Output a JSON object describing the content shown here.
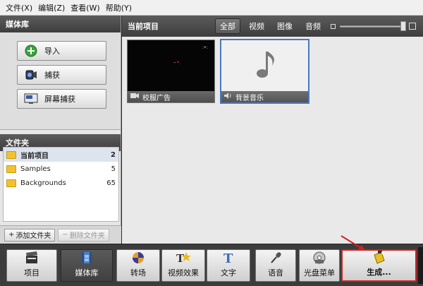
{
  "menu": [
    "文件(X)",
    "编辑(Z)",
    "查看(W)",
    "帮助(Y)"
  ],
  "media_library": {
    "header": "媒体库",
    "buttons": [
      {
        "label": "导入",
        "icon": "plus-circle-icon"
      },
      {
        "label": "捕获",
        "icon": "camcorder-icon"
      },
      {
        "label": "屏幕捕获",
        "icon": "screen-capture-icon"
      }
    ]
  },
  "folders": {
    "header": "文件夹",
    "items": [
      {
        "name": "当前项目",
        "count": "2",
        "selected": true
      },
      {
        "name": "Samples",
        "count": "5",
        "selected": false
      },
      {
        "name": "Backgrounds",
        "count": "65",
        "selected": false
      }
    ],
    "add_label": "添加文件夹",
    "delete_label": "删除文件夹"
  },
  "project": {
    "header": "当前项目",
    "filters": [
      "全部",
      "视频",
      "图像",
      "音频"
    ],
    "active_filter": "全部",
    "items": [
      {
        "name": "校服广告",
        "type": "video"
      },
      {
        "name": "背景音乐",
        "type": "audio",
        "selected": true
      }
    ]
  },
  "toolbar": {
    "items": [
      {
        "label": "项目",
        "icon": "clapperboard-icon"
      },
      {
        "label": "媒体库",
        "icon": "film-strip-icon",
        "active": true
      },
      {
        "label": "转场",
        "icon": "transition-icon"
      },
      {
        "label": "视频效果",
        "icon": "video-effects-icon"
      },
      {
        "label": "文字",
        "icon": "text-t-icon"
      },
      {
        "label": "语音",
        "icon": "microphone-icon"
      },
      {
        "label": "光盘菜单",
        "icon": "disc-menu-icon"
      },
      {
        "label": "生成...",
        "icon": "produce-icon",
        "highlighted": true
      }
    ]
  },
  "colors": {
    "accent_red": "#d62020",
    "selection_blue": "#4a78c0"
  }
}
